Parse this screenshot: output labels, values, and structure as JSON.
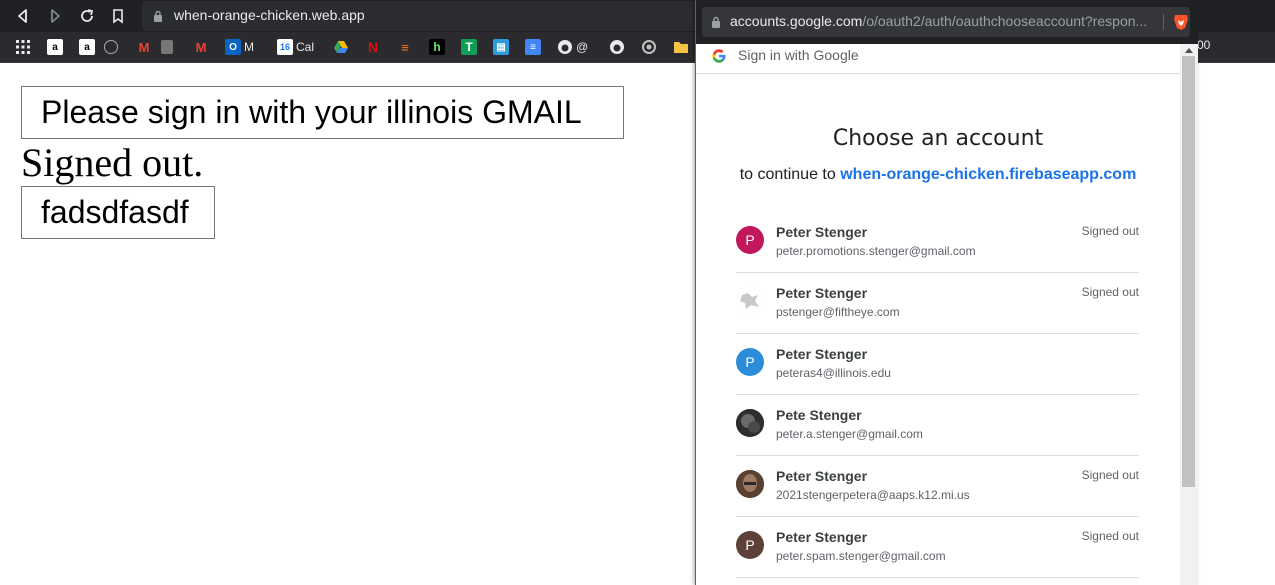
{
  "browser": {
    "url": "when-orange-chicken.web.app",
    "bookmarks": [
      {
        "icon": "apps-grid-icon",
        "label": ""
      },
      {
        "icon": "amazon-icon",
        "label": ""
      },
      {
        "icon": "amazon-icon",
        "label": ""
      },
      {
        "icon": "github-icon",
        "label": ""
      },
      {
        "icon": "gmail-icon",
        "label": ""
      },
      {
        "icon": "trash-icon",
        "label": ""
      },
      {
        "icon": "gmail-icon",
        "label": ""
      },
      {
        "icon": "outlook-icon",
        "label": "M"
      },
      {
        "icon": "calendar-icon",
        "label": "Cal"
      },
      {
        "icon": "google-drive-icon",
        "label": ""
      },
      {
        "icon": "netflix-icon",
        "label": ""
      },
      {
        "icon": "stackoverflow-icon",
        "label": ""
      },
      {
        "icon": "h-icon",
        "label": ""
      },
      {
        "icon": "sheets-icon",
        "label": ""
      },
      {
        "icon": "book-icon",
        "label": ""
      },
      {
        "icon": "docs-icon",
        "label": ""
      },
      {
        "icon": "github-icon",
        "label": "@"
      },
      {
        "icon": "github-icon",
        "label": ""
      },
      {
        "icon": "circle-icon",
        "label": ""
      },
      {
        "icon": "folder-icon",
        "label": ""
      }
    ],
    "bookmarks_overflow": "00",
    "colors": {
      "chrome": "#202124",
      "bookmarks_bar": "#2b2b2f"
    }
  },
  "page": {
    "signin_button": "Please sign in with your illinois GMAIL",
    "status": "Signed out.",
    "other_button": "fadsdfasdf"
  },
  "popup": {
    "url_domain": "accounts.google.com",
    "url_path": "/o/oauth2/auth/oauthchooseaccount?respon...",
    "header": "Sign in with Google",
    "title": "Choose an account",
    "continue_prefix": "to continue to",
    "continue_link": "when-orange-chicken.firebaseapp.com",
    "accounts": [
      {
        "name": "Peter Stenger",
        "email": "peter.promotions.stenger@gmail.com",
        "status": "Signed out",
        "avatar_letter": "P",
        "avatar_color": "#c2185b"
      },
      {
        "name": "Peter Stenger",
        "email": "pstenger@fiftheye.com",
        "status": "Signed out",
        "avatar_letter": "",
        "avatar_color": "#d8d8d8"
      },
      {
        "name": "Peter Stenger",
        "email": "peteras4@illinois.edu",
        "status": "",
        "avatar_letter": "P",
        "avatar_color": "#2d8cd8"
      },
      {
        "name": "Pete Stenger",
        "email": "peter.a.stenger@gmail.com",
        "status": "",
        "avatar_letter": "",
        "avatar_color": "#3a3a3a"
      },
      {
        "name": "Peter Stenger",
        "email": "2021stengerpetera@aaps.k12.mi.us",
        "status": "Signed out",
        "avatar_letter": "",
        "avatar_color": "#7a5a48"
      },
      {
        "name": "Peter Stenger",
        "email": "peter.spam.stenger@gmail.com",
        "status": "Signed out",
        "avatar_letter": "P",
        "avatar_color": "#5d4037"
      }
    ],
    "colors": {
      "link": "#1a73e8",
      "divider": "#dadce0"
    }
  }
}
